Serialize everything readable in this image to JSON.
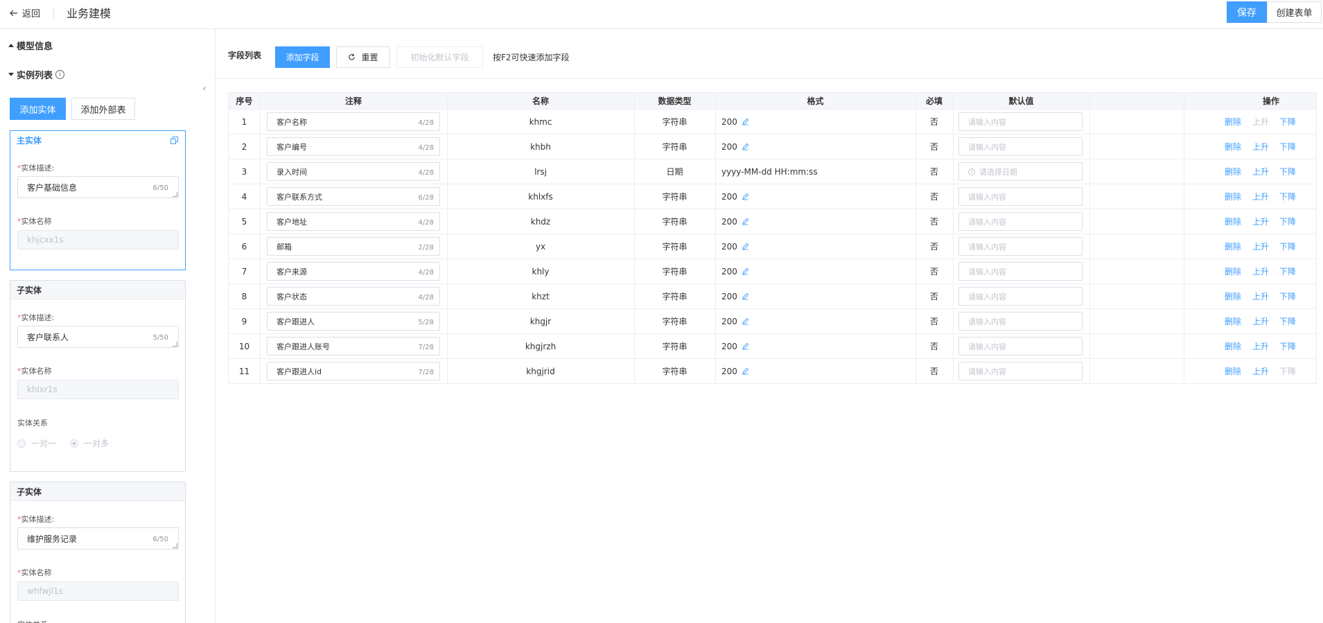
{
  "header": {
    "back_label": "返回",
    "title": "业务建模",
    "save_label": "保存",
    "create_form_label": "创建表单"
  },
  "left": {
    "model_info_label": "模型信息",
    "instance_list_label": "实例列表",
    "add_entity_label": "添加实体",
    "add_external_label": "添加外部表",
    "desc_label": "实体描述:",
    "name_label": "实体名称",
    "relation_label": "实体关系",
    "one_to_one": "一对一",
    "one_to_many": "一对多",
    "main_entity": {
      "title": "主实体",
      "description": "客户基础信息",
      "desc_count": "6/50",
      "name": "khjcxx1s"
    },
    "sub_entities": [
      {
        "title": "子实体",
        "description": "客户联系人",
        "desc_count": "5/50",
        "name": "khlxr1s"
      },
      {
        "title": "子实体",
        "description": "维护服务记录",
        "desc_count": "6/50",
        "name": "whfwjl1s"
      }
    ]
  },
  "toolbar": {
    "label": "字段列表",
    "add_field": "添加字段",
    "reset": "重置",
    "init_default": "初始化默认字段",
    "hint": "按F2可快速添加字段"
  },
  "table": {
    "headers": {
      "index": "序号",
      "comment": "注释",
      "name": "名称",
      "type": "数据类型",
      "format": "格式",
      "required": "必填",
      "default": "默认值",
      "ops": "操作"
    },
    "default_placeholder": "请输入内容",
    "date_placeholder": "请选择日期",
    "op_delete": "删除",
    "op_up": "上升",
    "op_down": "下降",
    "rows": [
      {
        "index": "1",
        "comment": "客户名称",
        "count": "4/28",
        "name": "khmc",
        "type": "字符串",
        "format": "200",
        "required": "否"
      },
      {
        "index": "2",
        "comment": "客户编号",
        "count": "4/28",
        "name": "khbh",
        "type": "字符串",
        "format": "200",
        "required": "否"
      },
      {
        "index": "3",
        "comment": "录入时间",
        "count": "4/28",
        "name": "lrsj",
        "type": "日期",
        "format": "yyyy-MM-dd HH:mm:ss",
        "required": "否"
      },
      {
        "index": "4",
        "comment": "客户联系方式",
        "count": "6/28",
        "name": "khlxfs",
        "type": "字符串",
        "format": "200",
        "required": "否"
      },
      {
        "index": "5",
        "comment": "客户地址",
        "count": "4/28",
        "name": "khdz",
        "type": "字符串",
        "format": "200",
        "required": "否"
      },
      {
        "index": "6",
        "comment": "邮箱",
        "count": "2/28",
        "name": "yx",
        "type": "字符串",
        "format": "200",
        "required": "否"
      },
      {
        "index": "7",
        "comment": "客户来源",
        "count": "4/28",
        "name": "khly",
        "type": "字符串",
        "format": "200",
        "required": "否"
      },
      {
        "index": "8",
        "comment": "客户状态",
        "count": "4/28",
        "name": "khzt",
        "type": "字符串",
        "format": "200",
        "required": "否"
      },
      {
        "index": "9",
        "comment": "客户跟进人",
        "count": "5/28",
        "name": "khgjr",
        "type": "字符串",
        "format": "200",
        "required": "否"
      },
      {
        "index": "10",
        "comment": "客户跟进人账号",
        "count": "7/28",
        "name": "khgjrzh",
        "type": "字符串",
        "format": "200",
        "required": "否"
      },
      {
        "index": "11",
        "comment": "客户跟进人id",
        "count": "7/28",
        "name": "khgjrid",
        "type": "字符串",
        "format": "200",
        "required": "否"
      }
    ]
  },
  "colors": {
    "accent": "#409eff",
    "disabled_text": "#c0c4cc",
    "border": "#dcdfe6"
  }
}
